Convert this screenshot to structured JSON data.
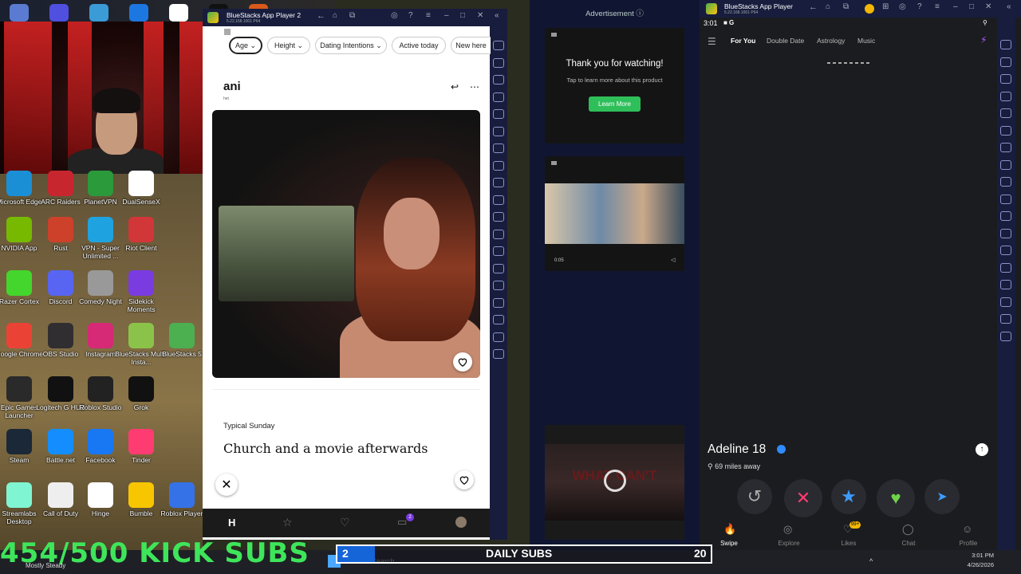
{
  "desktop": {
    "icons": [
      {
        "label": "Microsoft Edge",
        "icon": "edge-icon",
        "color": "#1a8fd6"
      },
      {
        "label": "ARC Raiders",
        "icon": "arc-raiders-icon",
        "color": "#c8262e"
      },
      {
        "label": "PlanetVPN",
        "icon": "planetvpn-icon",
        "color": "#2a9a3a"
      },
      {
        "label": "DualSenseX",
        "icon": "dualsensex-icon",
        "color": "#ffffff"
      },
      {
        "label": "NVIDIA App",
        "icon": "nvidia-icon",
        "color": "#76b900"
      },
      {
        "label": "Rust",
        "icon": "rust-icon",
        "color": "#cd412b"
      },
      {
        "label": "VPN - Super Unlimited ...",
        "icon": "vpn-key-icon",
        "color": "#1fa3e0"
      },
      {
        "label": "Riot Client",
        "icon": "riot-icon",
        "color": "#d13639"
      },
      {
        "label": "Razer Cortex",
        "icon": "razer-icon",
        "color": "#44d62c"
      },
      {
        "label": "Discord",
        "icon": "discord-icon",
        "color": "#5865f2"
      },
      {
        "label": "Comedy Night",
        "icon": "microphone-icon",
        "color": "#999999"
      },
      {
        "label": "Sidekick Moments",
        "icon": "sidekick-icon",
        "color": "#7a3be0"
      },
      {
        "label": "Google Chrome",
        "icon": "chrome-icon",
        "color": "#ea4335"
      },
      {
        "label": "OBS Studio",
        "icon": "obs-icon",
        "color": "#302e31"
      },
      {
        "label": "Instagram",
        "icon": "instagram-icon",
        "color": "#d62976"
      },
      {
        "label": "BlueStacks Multi-Insta...",
        "icon": "bluestacks-multi-icon",
        "color": "#8bc34a"
      },
      {
        "label": "BlueStacks 5",
        "icon": "bluestacks-icon",
        "color": "#4caf50"
      },
      {
        "label": "Epic Games Launcher",
        "icon": "epic-games-icon",
        "color": "#2a2a2a"
      },
      {
        "label": "Logitech G HUB",
        "icon": "logitech-icon",
        "color": "#111111"
      },
      {
        "label": "Roblox Studio",
        "icon": "roblox-studio-icon",
        "color": "#222222"
      },
      {
        "label": "Grok",
        "icon": "grok-icon",
        "color": "#111111"
      },
      {
        "label": "Steam",
        "icon": "steam-icon",
        "color": "#1b2838"
      },
      {
        "label": "Battle.net",
        "icon": "battlenet-icon",
        "color": "#148eff"
      },
      {
        "label": "Facebook",
        "icon": "facebook-icon",
        "color": "#1877f2"
      },
      {
        "label": "Tinder",
        "icon": "tinder-icon",
        "color": "#fe3c72"
      },
      {
        "label": "Streamlabs Desktop",
        "icon": "streamlabs-icon",
        "color": "#80f5d2"
      },
      {
        "label": "Call of Duty",
        "icon": "file-icon",
        "color": "#eeeeee"
      },
      {
        "label": "Hinge",
        "icon": "hinge-icon",
        "color": "#ffffff"
      },
      {
        "label": "Bumble",
        "icon": "bumble-icon",
        "color": "#f7c600"
      },
      {
        "label": "Roblox Player",
        "icon": "roblox-icon",
        "color": "#3572e8"
      }
    ]
  },
  "bs1": {
    "title": "BlueStacks App Player 2",
    "subtitle": "5.22.168.1001 P64",
    "filters": [
      "Age",
      "Height",
      "Dating Intentions",
      "Active today",
      "New here"
    ],
    "profile_name": "ani",
    "profile_sub": "het",
    "prompt_label": "Typical Sunday",
    "prompt_answer": "Church and a movie afterwards",
    "chat_badge": "2"
  },
  "ad": {
    "header": "Advertisement",
    "thank_you": "Thank you for watching!",
    "tap_text": "Tap to learn more about this product",
    "learn_more": "Learn More",
    "video_time": "0:05",
    "bottom_overlay": "WHAT CAN'T"
  },
  "bs2": {
    "title": "BlueStacks App Player",
    "subtitle": "5.22.168.1001 P64",
    "status_time": "3:01",
    "tabs": [
      "For You",
      "Double Date",
      "Astrology",
      "Music"
    ],
    "profile_name": "Adeline 18",
    "distance": "69 miles away",
    "nav": [
      "Swipe",
      "Explore",
      "Likes",
      "Chat",
      "Profile"
    ],
    "likes_badge": "99+"
  },
  "overlay": {
    "kick_subs": "454/500 KICK SUBS",
    "daily_label": "DAILY SUBS",
    "daily_left": "2",
    "daily_right": "20",
    "caption": "Mostly Steady"
  },
  "taskbar": {
    "search_placeholder": "Search",
    "time": "3:01 PM",
    "date": "4/26/2026"
  },
  "colors": {
    "bluestacks_frame": "#181d3d",
    "kick_green": "#3ee55a",
    "learn_more_green": "#2fbf5a",
    "daily_blue": "#1565d8",
    "tinder_pink": "#fe3c72"
  }
}
